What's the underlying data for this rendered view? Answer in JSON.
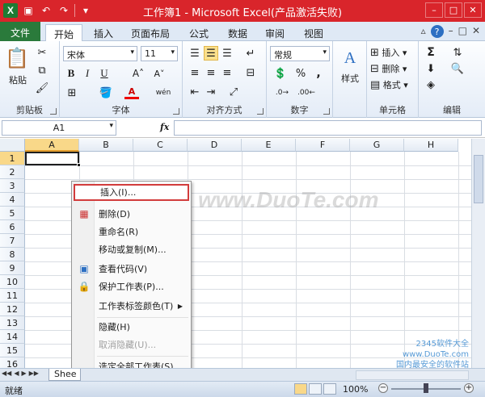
{
  "window": {
    "title": "工作簿1 - Microsoft Excel(产品激活失败)",
    "logo_letter": "X",
    "controls": [
      "–",
      "□",
      "✕"
    ]
  },
  "tabs": [
    {
      "label": "文件"
    },
    {
      "label": "开始"
    },
    {
      "label": "插入"
    },
    {
      "label": "页面布局"
    },
    {
      "label": "公式"
    },
    {
      "label": "数据"
    },
    {
      "label": "审阅"
    },
    {
      "label": "视图"
    }
  ],
  "tab_right": {
    "help": "?",
    "minimize": "–",
    "restore": "□",
    "close": "✕"
  },
  "ribbon": {
    "clipboard": {
      "label": "剪贴板",
      "paste": "粘贴"
    },
    "font": {
      "label": "字体",
      "family": "宋体",
      "size": "11",
      "bold": "B",
      "italic": "I",
      "underline": "U",
      "grow": "A˄",
      "shrink": "A˅",
      "color": "A",
      "wen": "wén"
    },
    "alignment": {
      "label": "对齐方式"
    },
    "number": {
      "label": "数字",
      "format": "常规",
      "percent": "%",
      "comma": ","
    },
    "styles": {
      "label": "样式"
    },
    "cells": {
      "label": "单元格",
      "insert": "插入",
      "delete": "删除",
      "format": "格式"
    },
    "editing": {
      "label": "编辑",
      "sigma": "Σ"
    }
  },
  "formula_bar": {
    "name_box": "A1",
    "fx": "fx"
  },
  "columns": [
    "A",
    "B",
    "C",
    "D",
    "E",
    "F",
    "G",
    "H"
  ],
  "rows": [
    "1",
    "2",
    "3",
    "4",
    "5",
    "6",
    "7",
    "8",
    "9",
    "10",
    "11",
    "12",
    "13",
    "14",
    "15",
    "16"
  ],
  "context_menu": [
    {
      "label": "插入(I)...",
      "icon": "",
      "state": "highlight"
    },
    {
      "label": "删除(D)",
      "icon": "delete-sheet-icon",
      "state": "normal"
    },
    {
      "label": "重命名(R)",
      "icon": "",
      "state": "normal"
    },
    {
      "label": "移动或复制(M)...",
      "icon": "",
      "state": "normal"
    },
    {
      "label": "查看代码(V)",
      "icon": "view-code-icon",
      "state": "normal"
    },
    {
      "label": "保护工作表(P)...",
      "icon": "protect-sheet-icon",
      "state": "normal"
    },
    {
      "label": "工作表标签颜色(T)",
      "icon": "",
      "state": "submenu"
    },
    {
      "label": "隐藏(H)",
      "icon": "",
      "state": "normal"
    },
    {
      "label": "取消隐藏(U)...",
      "icon": "",
      "state": "disabled"
    },
    {
      "label": "选定全部工作表(S)",
      "icon": "",
      "state": "normal"
    }
  ],
  "sheet_tab": "Shee",
  "status": {
    "ready": "就绪",
    "zoom": "100%"
  },
  "watermark": {
    "main": "www.DuoTe.com",
    "corner_brand": "2345软件大全",
    "corner_url": "www.DuoTe.com",
    "corner_note": "国内最安全的软件站"
  },
  "colors": {
    "title_bar": "#d9252b",
    "file_tab": "#2a7a3b",
    "highlight_border": "#d23c3c"
  }
}
